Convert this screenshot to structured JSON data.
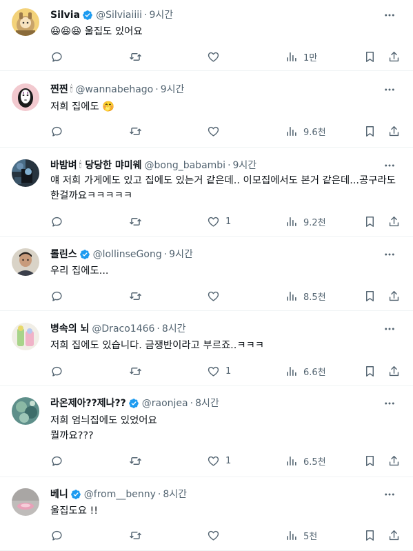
{
  "tweets": [
    {
      "display_name": "Silvia",
      "verified": true,
      "name_emoji": "",
      "name_suffix": "",
      "handle": "@Silviaiiii",
      "time": "9시간",
      "text": "😆😆😆 울집도 있어요",
      "replies": "",
      "retweets": "",
      "likes": "",
      "views": "1만"
    },
    {
      "display_name": "찐찐",
      "verified": false,
      "name_emoji": "🕯",
      "name_suffix": "",
      "handle": "@wannabehago",
      "time": "9시간",
      "text": "저희 집에도 🤭",
      "replies": "",
      "retweets": "",
      "likes": "",
      "views": "9.6천"
    },
    {
      "display_name": "바밤벼",
      "verified": false,
      "name_emoji": "🕯",
      "name_suffix": "당당한 먀미웨",
      "handle": "@bong_babambi",
      "time": "9시간",
      "text": "얘 저희 가게에도 있고 집에도 있는거 같은데.. 이모집에서도 본거 같은데...공구라도 한걸까요ㅋㅋㅋㅋㅋ",
      "replies": "",
      "retweets": "",
      "likes": "1",
      "views": "9.2천"
    },
    {
      "display_name": "롤린스",
      "verified": true,
      "name_emoji": "",
      "name_suffix": "",
      "handle": "@lollinseGong",
      "time": "9시간",
      "text": "우리 집에도...",
      "replies": "",
      "retweets": "",
      "likes": "",
      "views": "8.5천"
    },
    {
      "display_name": "병속의 뇌",
      "verified": false,
      "name_emoji": "",
      "name_suffix": "",
      "handle": "@Draco1466",
      "time": "8시간",
      "text": "저희 집에도 있습니다. 금쟁반이라고 부르죠..ㅋㅋㅋ",
      "replies": "",
      "retweets": "",
      "likes": "1",
      "views": "6.6천"
    },
    {
      "display_name": "라온제아??제나??",
      "verified": true,
      "name_emoji": "",
      "name_suffix": "",
      "handle": "@raonjea",
      "time": "8시간",
      "text": "저희 엄늬집에도 있었어요\n뭘까요???",
      "replies": "",
      "retweets": "",
      "likes": "1",
      "views": "6.5천"
    },
    {
      "display_name": "베니",
      "verified": true,
      "name_emoji": "",
      "name_suffix": "",
      "handle": "@from__benny",
      "time": "8시간",
      "text": "울집도요 !!",
      "replies": "",
      "retweets": "",
      "likes": "",
      "views": "5천"
    }
  ],
  "icons": {
    "more": "more-horizontal-icon",
    "reply": "reply-bubble-icon",
    "retweet": "retweet-icon",
    "like": "heart-icon",
    "views": "views-bar-chart-icon",
    "bookmark": "bookmark-icon",
    "share": "share-upload-icon",
    "verified": "verified-badge-icon"
  },
  "colors": {
    "text_primary": "#0f1419",
    "text_secondary": "#536471",
    "verified_blue": "#1d9bf0",
    "divider": "#eff3f4"
  }
}
